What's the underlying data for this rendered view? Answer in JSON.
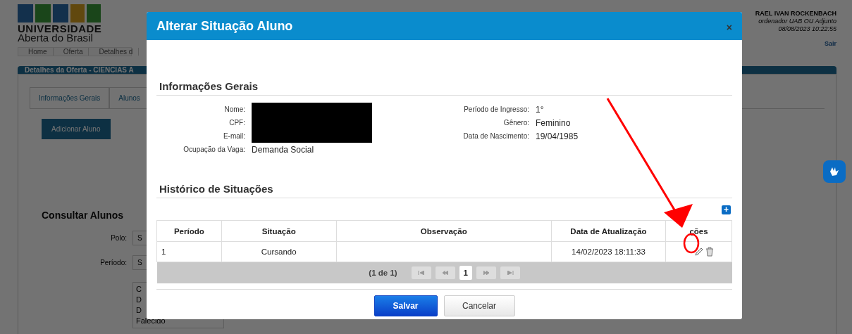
{
  "background": {
    "logo": {
      "line1": "UNIVERSIDADE",
      "line2": "Aberta do Brasil"
    },
    "user": {
      "name": "RAEL IVAN ROCKENBACH",
      "role": "ordenador UAB OU Adjunto",
      "datetime": "08/08/2023 10:22:55",
      "logout": "Sair"
    },
    "breadcrumb": [
      "Home",
      "Oferta",
      "Detalhes d"
    ],
    "panel_title": "Detalhes da Oferta - CIENCIAS A",
    "tabs": [
      "Informações Gerais",
      "Alunos"
    ],
    "add_button": "Adicionar Aluno",
    "search_title": "Consultar Alunos",
    "filters": [
      {
        "label": "Polo:",
        "value": "S"
      },
      {
        "label": "Período:",
        "value": "S"
      }
    ],
    "status_list": [
      "C",
      "D",
      "D",
      "Falecido"
    ]
  },
  "dialog": {
    "title": "Alterar Situação Aluno",
    "close": "×",
    "general_title": "Informações Gerais",
    "left_fields": [
      {
        "label": "Nome:",
        "redacted": true
      },
      {
        "label": "CPF:",
        "redacted": true
      },
      {
        "label": "E-mail:",
        "redacted": true
      },
      {
        "label": "Ocupação da Vaga:",
        "value": "Demanda Social",
        "redacted": false
      }
    ],
    "right_fields": [
      {
        "label": "Período de Ingresso:",
        "value": "1°"
      },
      {
        "label": "Gênero:",
        "value": "Feminino"
      },
      {
        "label": "Data de Nascimento:",
        "value": "19/04/1985"
      }
    ],
    "history_title": "Histórico de Situações",
    "add_icon": "+",
    "columns": [
      "Período",
      "Situação",
      "Observação",
      "Data de Atualização",
      "ções"
    ],
    "rows": [
      {
        "period": "1",
        "status": "Cursando",
        "updated": "14/02/2023 18:11:33"
      }
    ],
    "pager": {
      "summary": "(1 de 1)",
      "pages": [
        {
          "label": "1",
          "selected": true
        }
      ]
    },
    "buttons": [
      {
        "label": "Salvar",
        "kind": "primary"
      },
      {
        "label": "Cancelar",
        "kind": "secondary"
      }
    ]
  }
}
